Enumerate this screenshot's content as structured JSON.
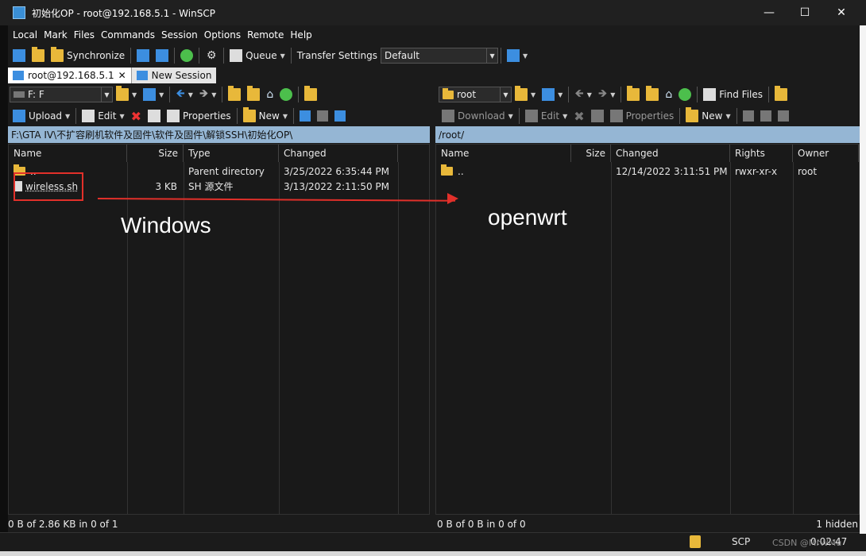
{
  "window": {
    "title": "初始化OP - root@192.168.5.1 - WinSCP"
  },
  "menu": [
    "Local",
    "Mark",
    "Files",
    "Commands",
    "Session",
    "Options",
    "Remote",
    "Help"
  ],
  "toolbar": {
    "synchronize": "Synchronize",
    "queue": "Queue",
    "transfer_settings": "Transfer Settings",
    "transfer_default": "Default"
  },
  "tabs": [
    {
      "label": "root@192.168.5.1",
      "close": "✕"
    },
    {
      "label": "New Session"
    }
  ],
  "left": {
    "drive": "F: F",
    "upload": "Upload",
    "edit": "Edit",
    "properties": "Properties",
    "new": "New",
    "path": "F:\\GTA IV\\不扩容刷机软件及固件\\软件及固件\\解锁SSH\\初始化OP\\",
    "columns": [
      "Name",
      "Size",
      "Type",
      "Changed"
    ],
    "rows": [
      {
        "name": "..",
        "size": "",
        "type": "Parent directory",
        "changed": "3/25/2022  6:35:44 PM"
      },
      {
        "name": "wireless.sh",
        "size": "3 KB",
        "type": "SH 源文件",
        "changed": "3/13/2022  2:11:50 PM"
      }
    ],
    "status": "0 B of 2.86 KB in 0 of 1"
  },
  "right": {
    "drive": "root",
    "find_files": "Find Files",
    "download": "Download",
    "edit": "Edit",
    "properties": "Properties",
    "new": "New",
    "path": "/root/",
    "columns": [
      "Name",
      "Size",
      "Changed",
      "Rights",
      "Owner"
    ],
    "rows": [
      {
        "name": "..",
        "size": "",
        "changed": "12/14/2022 3:11:51 PM",
        "rights": "rwxr-xr-x",
        "owner": "root"
      }
    ],
    "status": "0 B of 0 B in 0 of 0",
    "hidden": "1 hidden"
  },
  "bottom": {
    "protocol": "SCP",
    "time": "0:02:47",
    "watermark": "CSDN @MrWMu"
  },
  "annotations": {
    "left_label": "Windows",
    "right_label": "openwrt"
  },
  "colors": {
    "path_bar": "#95b6d4",
    "annotation_red": "#e2302a",
    "bg": "#1b1b1b"
  }
}
